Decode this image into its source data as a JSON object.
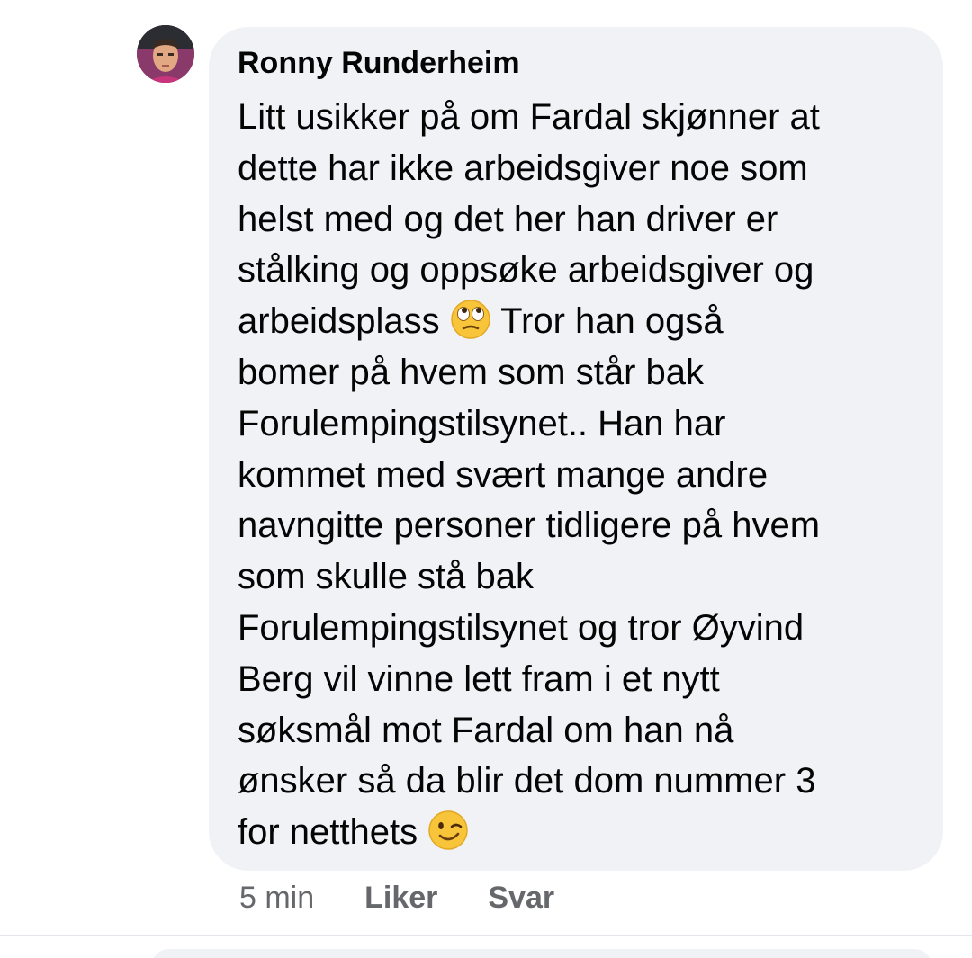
{
  "comment": {
    "author": "Ronny Runderheim",
    "lines": [
      {
        "text": "Litt usikker på om Fardal skjønner at"
      },
      {
        "text": "dette har ikke arbeidsgiver noe som"
      },
      {
        "text": "helst med og det her han driver er"
      },
      {
        "text": "stålking og oppsøke arbeidsgiver og"
      },
      {
        "text": "arbeidsplass ",
        "emoji": "face-with-rolling-eyes",
        "after": " Tror han også"
      },
      {
        "text": "bomer på hvem som står bak"
      },
      {
        "text": "Forulempingstilsynet.. Han har"
      },
      {
        "text": "kommet med svært mange andre"
      },
      {
        "text": "navngitte personer tidligere på hvem"
      },
      {
        "text": "som skulle stå bak"
      },
      {
        "text": "Forulempingstilsynet og tror Øyvind"
      },
      {
        "text": "Berg vil vinne lett fram i et nytt"
      },
      {
        "text": "søksmål mot Fardal om han nå"
      },
      {
        "text": "ønsker så da blir det dom nummer 3"
      },
      {
        "text": "for netthets ",
        "emoji": "winking-face",
        "after": ""
      }
    ]
  },
  "actions": {
    "timestamp": "5 min",
    "like_label": "Liker",
    "reply_label": "Svar"
  },
  "colors": {
    "bubble": "#f0f2f5",
    "text": "#050505",
    "meta": "#65676b"
  }
}
